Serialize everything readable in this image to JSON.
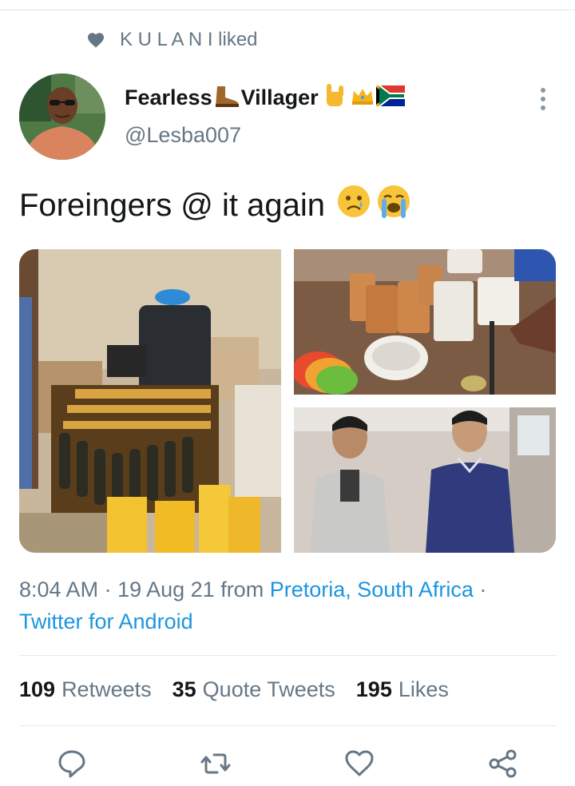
{
  "social_context": {
    "icon": "heart-icon",
    "text": "K U L A N I liked"
  },
  "author": {
    "display_name_part1": "Fearless",
    "display_name_part2": "Villager",
    "emojis": [
      "boot-emoji",
      "rock-hand-emoji",
      "crown-emoji",
      "south-africa-flag-emoji"
    ],
    "handle": "@Lesba007"
  },
  "tweet": {
    "text": "Foreingers @ it again",
    "emojis": [
      "sad-face-emoji",
      "loudly-crying-face-emoji"
    ],
    "media": [
      {
        "name": "photo-bottles-room"
      },
      {
        "name": "photo-containers"
      },
      {
        "name": "photo-two-men"
      }
    ]
  },
  "meta": {
    "time": "8:04 AM",
    "separator": " · ",
    "date": "19 Aug 21",
    "from": " from ",
    "location": "Pretoria, South Africa",
    "trailing_separator": " ·",
    "client": "Twitter for Android"
  },
  "stats": {
    "retweets_count": "109",
    "retweets_label": "Retweets",
    "quotes_count": "35",
    "quotes_label": "Quote Tweets",
    "likes_count": "195",
    "likes_label": "Likes"
  },
  "actions": [
    {
      "name": "reply-icon"
    },
    {
      "name": "retweet-icon"
    },
    {
      "name": "like-icon"
    },
    {
      "name": "share-icon"
    }
  ],
  "colors": {
    "link": "#1b95e0",
    "secondary_text": "#657786",
    "primary_text": "#14171a",
    "divider": "#e1e8ed"
  }
}
